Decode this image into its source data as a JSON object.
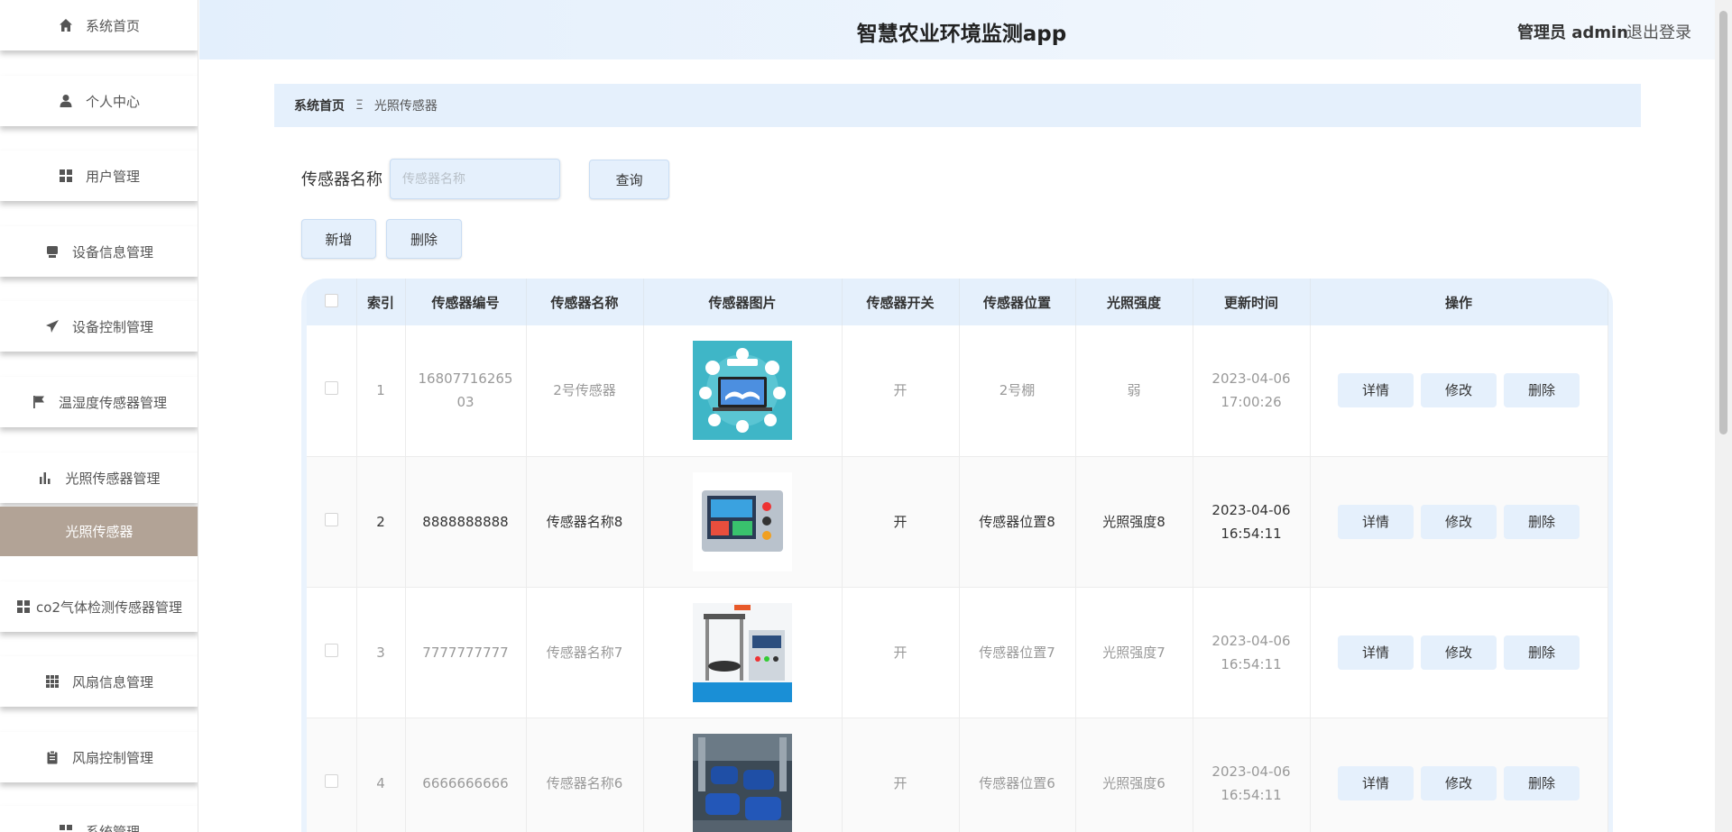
{
  "header": {
    "title": "智慧农业环境监测app",
    "user": "管理员 admin",
    "logout": "退出登录"
  },
  "sidebar": {
    "items": [
      {
        "label": "系统首页",
        "icon": "home-icon"
      },
      {
        "label": "个人中心",
        "icon": "user-icon"
      },
      {
        "label": "用户管理",
        "icon": "grid-icon"
      },
      {
        "label": "设备信息管理",
        "icon": "device-icon"
      },
      {
        "label": "设备控制管理",
        "icon": "paper-plane-icon"
      },
      {
        "label": "温湿度传感器管理",
        "icon": "flag-icon"
      },
      {
        "label": "光照传感器管理",
        "icon": "bar-chart-icon"
      },
      {
        "label": "光照传感器",
        "icon": ""
      },
      {
        "label": "co2气体检测传感器管理",
        "icon": "grid-icon"
      },
      {
        "label": "风扇信息管理",
        "icon": "grid9-icon"
      },
      {
        "label": "风扇控制管理",
        "icon": "clipboard-icon"
      },
      {
        "label": "系统管理",
        "icon": "grid-icon"
      }
    ]
  },
  "breadcrumb": {
    "home": "系统首页",
    "separator": "Ξ",
    "current": "光照传感器"
  },
  "search": {
    "label": "传感器名称",
    "placeholder": "传感器名称",
    "button": "查询"
  },
  "actions": {
    "add": "新增",
    "delete": "删除"
  },
  "table": {
    "headers": [
      "索引",
      "传感器编号",
      "传感器名称",
      "传感器图片",
      "传感器开关",
      "传感器位置",
      "光照强度",
      "更新时间",
      "操作"
    ],
    "rows": [
      {
        "index": "1",
        "code": "1680771626503",
        "name": "2号传感器",
        "image": "education-laptop-image",
        "switch": "开",
        "location": "2号棚",
        "light": "弱",
        "time": "2023-04-06 17:00:26"
      },
      {
        "index": "2",
        "code": "8888888888",
        "name": "传感器名称8",
        "image": "control-panel-image",
        "switch": "开",
        "location": "传感器位置8",
        "light": "光照强度8",
        "time": "2023-04-06 16:54:11"
      },
      {
        "index": "3",
        "code": "7777777777",
        "name": "传感器名称7",
        "image": "test-machine-image",
        "switch": "开",
        "location": "传感器位置7",
        "light": "光照强度7",
        "time": "2023-04-06 16:54:11"
      },
      {
        "index": "4",
        "code": "6666666666",
        "name": "传感器名称6",
        "image": "pumps-image",
        "switch": "开",
        "location": "传感器位置6",
        "light": "光照强度6",
        "time": "2023-04-06 16:54:11"
      }
    ],
    "row_actions": {
      "detail": "详情",
      "edit": "修改",
      "delete": "删除"
    }
  },
  "colors": {
    "accent": "#e5f0fc",
    "active_menu": "#b2a396"
  }
}
